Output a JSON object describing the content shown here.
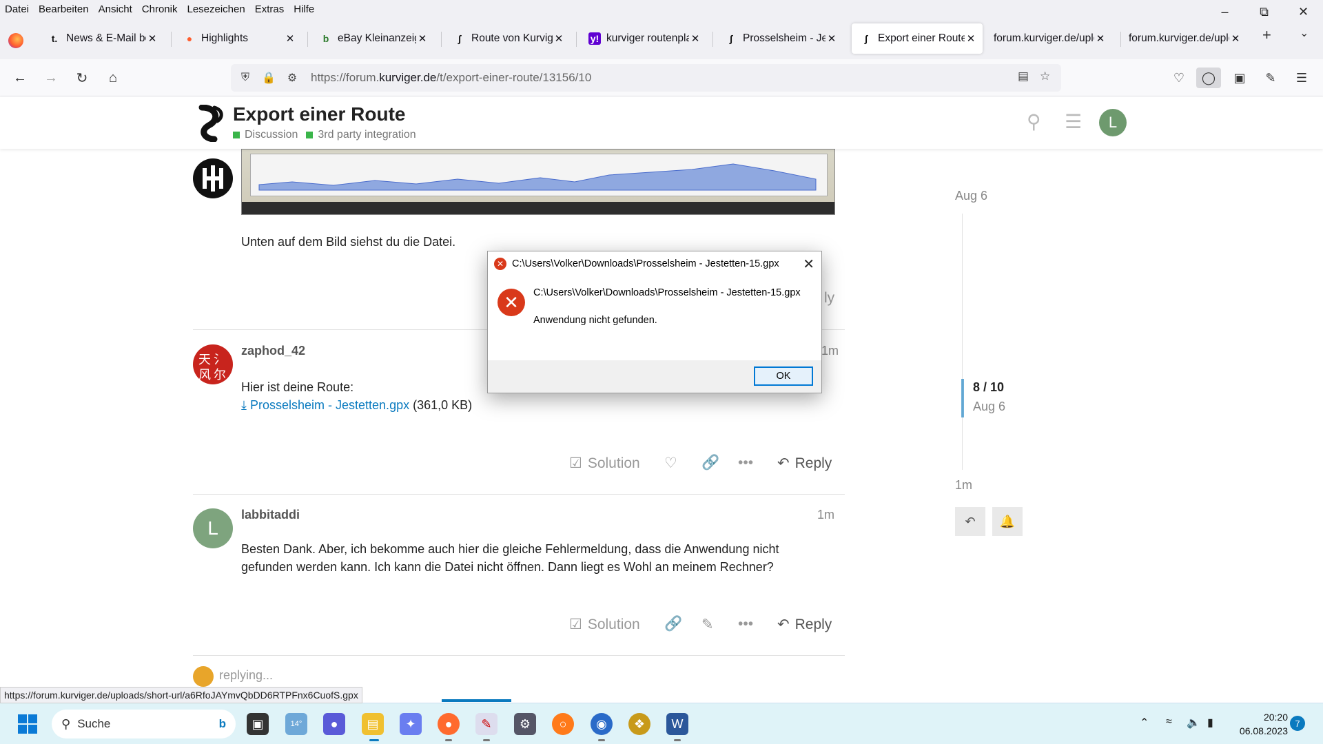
{
  "menu": [
    "Datei",
    "Bearbeiten",
    "Ansicht",
    "Chronik",
    "Lesezeichen",
    "Extras",
    "Hilfe"
  ],
  "tabs": [
    {
      "label": "News & E-Mail bei",
      "icon": "t-online-icon"
    },
    {
      "label": "Highlights",
      "icon": "flame-icon"
    },
    {
      "label": "eBay Kleinanzeigen",
      "icon": "ebay-kleinanzeigen-icon"
    },
    {
      "label": "Route von Kurviger",
      "icon": "kurviger-icon"
    },
    {
      "label": "kurviger routenplan",
      "icon": "yahoo-icon"
    },
    {
      "label": "Prosselsheim - Jest",
      "icon": "kurviger-icon"
    },
    {
      "label": "Export einer Route",
      "icon": "kurviger-icon",
      "active": true
    },
    {
      "label": "forum.kurviger.de/uplo",
      "icon": "none"
    },
    {
      "label": "forum.kurviger.de/uplo",
      "icon": "none"
    }
  ],
  "urlbar": {
    "prefix": "https://forum.",
    "domain": "kurviger.de",
    "path": "/t/export-einer-route/13156/10"
  },
  "topic": {
    "title": "Export einer Route",
    "categories": [
      "Discussion",
      "3rd party integration"
    ],
    "avatar_letter": "L"
  },
  "posts": {
    "first": {
      "text": "Unten auf dem Bild siehst du die Datei."
    },
    "second": {
      "username": "zaphod_42",
      "time": "1m",
      "text": "Hier ist deine Route:",
      "link": "Prosselsheim - Jestetten.gpx",
      "size": "(361,0 KB)",
      "actions": {
        "solution": "Solution",
        "reply": "Reply"
      }
    },
    "third": {
      "username": "labbitaddi",
      "avatar_letter": "L",
      "time": "1m",
      "text_line1": "Besten Dank. Aber, ich bekomme auch hier die gleiche Fehlermeldung, dass die Anwendung nicht",
      "text_line2": "gefunden werden kann. Ich kann die Datei nicht öffnen. Dann liegt es Wohl an meinem Rechner?",
      "actions": {
        "solution": "Solution",
        "reply": "Reply"
      }
    }
  },
  "timeline": {
    "top_date": "Aug 6",
    "position": "8 / 10",
    "position_date": "Aug 6",
    "bottom": "1m"
  },
  "dialog": {
    "title": "C:\\Users\\Volker\\Downloads\\Prosselsheim - Jestetten-15.gpx",
    "path": "C:\\Users\\Volker\\Downloads\\Prosselsheim - Jestetten-15.gpx",
    "message": "Anwendung nicht gefunden.",
    "ok": "OK"
  },
  "composer": {
    "status": "replying..."
  },
  "statusbar": {
    "url": "https://forum.kurviger.de/uploads/short-url/a6RfoJAYmvQbDD6RTPFnx6CuofS.gpx"
  },
  "taskbar": {
    "search_placeholder": "Suche",
    "weather": "14°",
    "time": "20:20",
    "date": "06.08.2023",
    "notifications": "7"
  },
  "colors": {
    "accent": "#0a7abf",
    "category": "#3ab54a",
    "error": "#d9391a"
  }
}
